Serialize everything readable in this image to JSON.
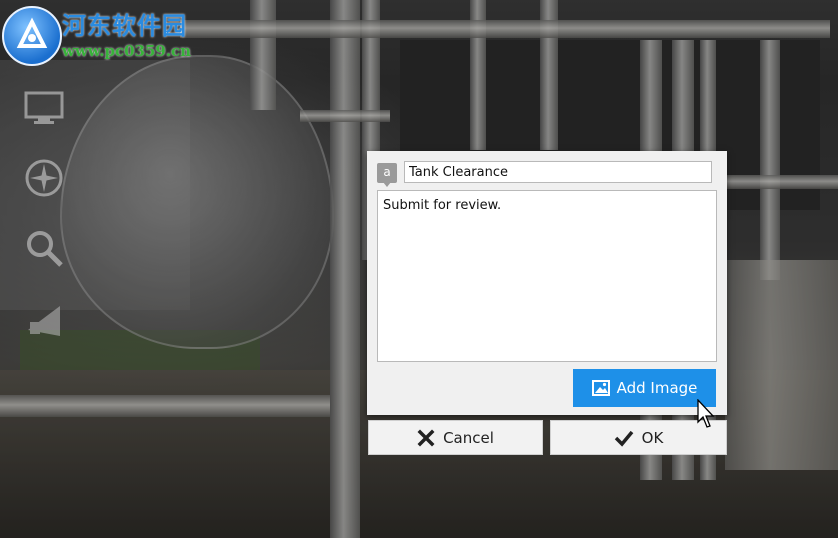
{
  "watermark": {
    "title": "河东软件园",
    "url": "www.pc0359.cn"
  },
  "toolbar": {
    "items": [
      {
        "icon": "monitor-icon"
      },
      {
        "icon": "compass-icon"
      },
      {
        "icon": "magnifier-icon"
      },
      {
        "icon": "megaphone-icon"
      }
    ]
  },
  "dialog": {
    "name_icon_glyph": "a",
    "name_value": "Tank Clearance",
    "description_value": "Submit for review.",
    "add_image_label": "Add Image",
    "cancel_label": "Cancel",
    "ok_label": "OK"
  },
  "colors": {
    "accent": "#1e90e8",
    "dialog_bg": "#f0f0f0"
  }
}
